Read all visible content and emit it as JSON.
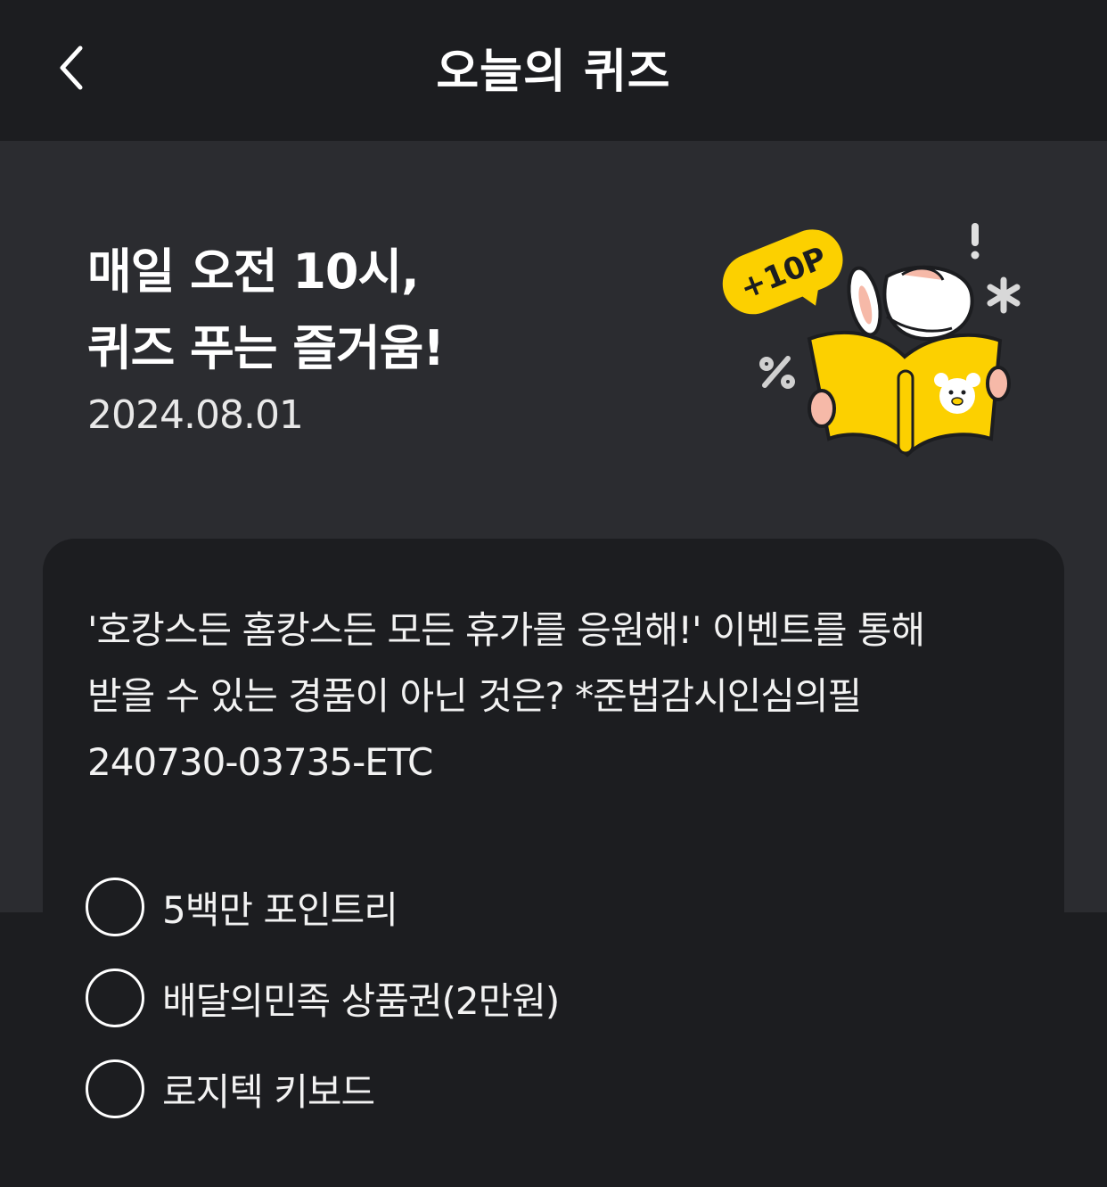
{
  "header": {
    "title": "오늘의 퀴즈",
    "back_icon": "chevron-left-icon"
  },
  "hero": {
    "headline_line1": "매일 오전 10시,",
    "headline_line2": "퀴즈 푸는 즐거움!",
    "date": "2024.08.01",
    "badge_text": "+10P",
    "accent_color": "#fcd000"
  },
  "quiz": {
    "question_line1": "'호캉스든 홈캉스든 모든 휴가를 응원해!' 이벤트를 통해",
    "question_line2": "받을 수 있는 경품이 아닌 것은? *준법감시인심의필",
    "question_line3": "240730-03735-ETC",
    "options": [
      {
        "label": "5백만 포인트리"
      },
      {
        "label": "배달의민족 상품권(2만원)"
      },
      {
        "label": "로지텍 키보드"
      }
    ]
  }
}
